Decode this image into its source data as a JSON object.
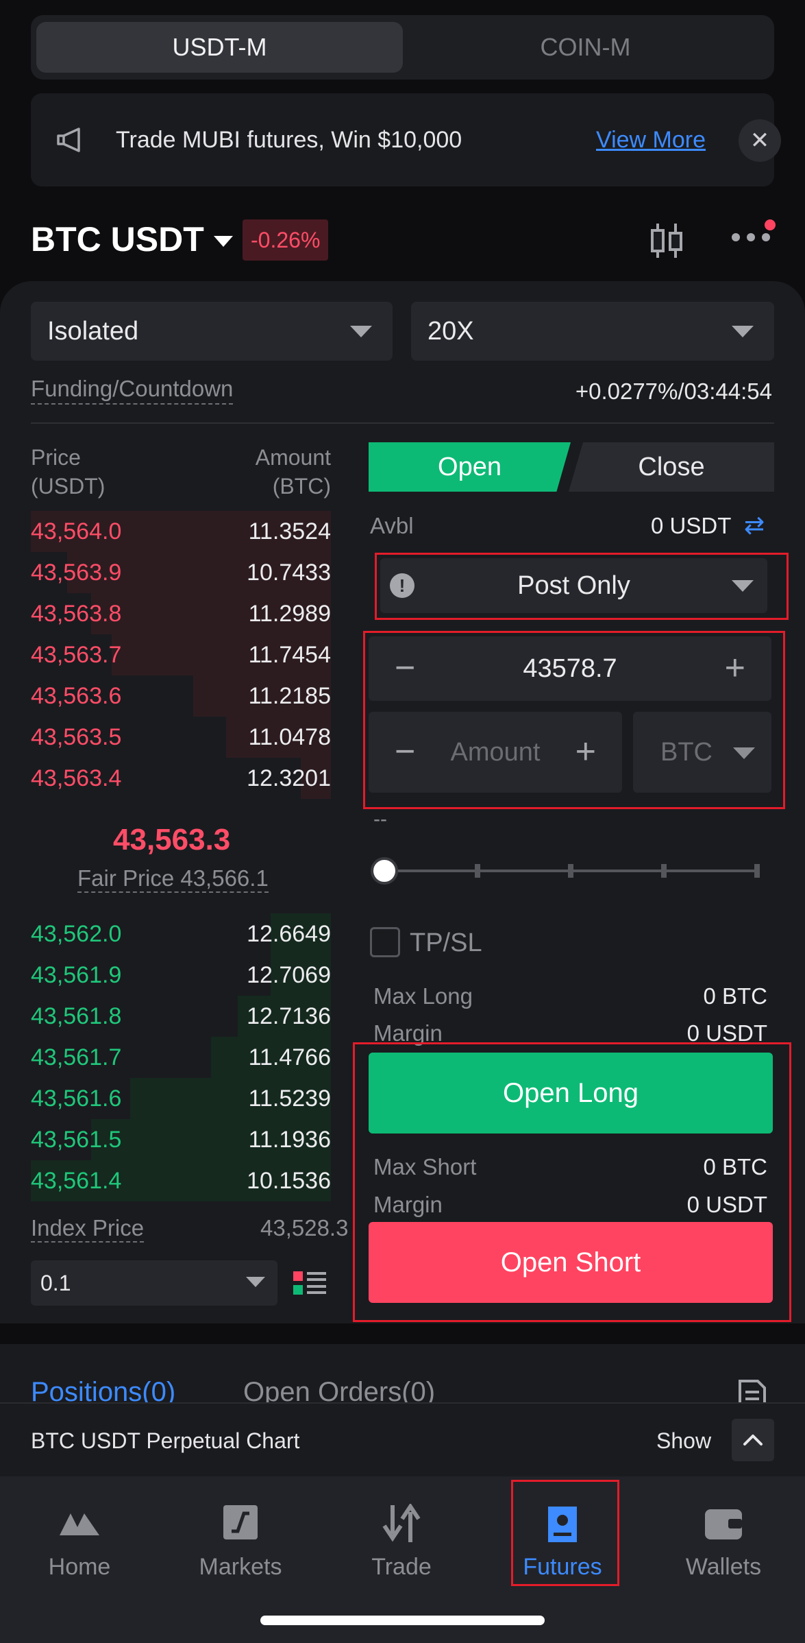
{
  "market_tabs": {
    "active": "USDT-M",
    "inactive": "COIN-M"
  },
  "banner": {
    "text": "Trade MUBI futures, Win $10,000",
    "link": "View More",
    "close": "✕"
  },
  "pair": {
    "name": "BTC USDT",
    "change": "-0.26%"
  },
  "margin_mode": "Isolated",
  "leverage": "20X",
  "funding": {
    "label": "Funding/Countdown",
    "value": "+0.0277%/03:44:54"
  },
  "orderbook": {
    "price_header": "Price\n(USDT)",
    "price_header_1": "Price",
    "price_header_2": "(USDT)",
    "amount_header_1": "Amount",
    "amount_header_2": "(BTC)",
    "asks": [
      {
        "price": "43,564.0",
        "amount": "11.3524",
        "depth": 1.0
      },
      {
        "price": "43,563.9",
        "amount": "10.7433",
        "depth": 0.88
      },
      {
        "price": "43,563.8",
        "amount": "11.2989",
        "depth": 0.8
      },
      {
        "price": "43,563.7",
        "amount": "11.7454",
        "depth": 0.73
      },
      {
        "price": "43,563.6",
        "amount": "11.2185",
        "depth": 0.46
      },
      {
        "price": "43,563.5",
        "amount": "11.0478",
        "depth": 0.35
      },
      {
        "price": "43,563.4",
        "amount": "12.3201",
        "depth": 0.1
      }
    ],
    "mid_price": "43,563.3",
    "fair_price": "Fair Price 43,566.1",
    "bids": [
      {
        "price": "43,562.0",
        "amount": "12.6649",
        "depth": 0.2
      },
      {
        "price": "43,561.9",
        "amount": "12.7069",
        "depth": 0.2
      },
      {
        "price": "43,561.8",
        "amount": "12.7136",
        "depth": 0.31
      },
      {
        "price": "43,561.7",
        "amount": "11.4766",
        "depth": 0.4
      },
      {
        "price": "43,561.6",
        "amount": "11.5239",
        "depth": 0.67
      },
      {
        "price": "43,561.5",
        "amount": "11.1936",
        "depth": 0.8
      },
      {
        "price": "43,561.4",
        "amount": "10.1536",
        "depth": 1.0
      }
    ],
    "index_label": "Index Price",
    "index_value": "43,528.3",
    "precision": "0.1"
  },
  "order_form": {
    "open_label": "Open",
    "close_label": "Close",
    "avbl_label": "Avbl",
    "avbl_value": "0 USDT",
    "order_type": "Post Only",
    "price_value": "43578.7",
    "amount_placeholder": "Amount",
    "amount_unit": "BTC",
    "estimate": "--",
    "tpsl_label": "TP/SL",
    "max_long_label": "Max Long",
    "max_long_value": "0 BTC",
    "margin_label": "Margin",
    "margin_long_value": "0 USDT",
    "open_long": "Open Long",
    "max_short_label": "Max Short",
    "max_short_value": "0 BTC",
    "margin_short_value": "0 USDT",
    "open_short": "Open Short"
  },
  "lower_tabs": {
    "positions": "Positions(0)",
    "open_orders": "Open Orders(0)"
  },
  "chart_bar": {
    "title": "BTC USDT Perpetual Chart",
    "toggle": "Show"
  },
  "nav": [
    {
      "label": "Home",
      "icon": "home-icon"
    },
    {
      "label": "Markets",
      "icon": "markets-icon"
    },
    {
      "label": "Trade",
      "icon": "trade-icon"
    },
    {
      "label": "Futures",
      "icon": "futures-icon",
      "active": true
    },
    {
      "label": "Wallets",
      "icon": "wallet-icon"
    }
  ],
  "colors": {
    "buy": "#0dba75",
    "sell": "#ff4461",
    "accent": "#3d8bff",
    "highlight_box": "#e31c2a"
  }
}
